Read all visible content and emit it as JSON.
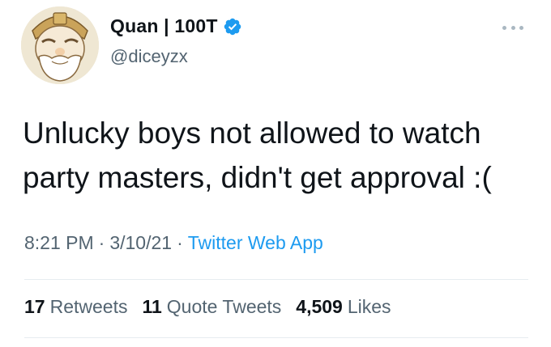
{
  "author": {
    "display_name": "Quan | 100T",
    "handle": "@diceyzx",
    "verified": true,
    "avatar_icon": "cartoon-grandpa-avatar"
  },
  "tweet": {
    "text": "Unlucky boys not allowed to watch party masters, didn't get approval :("
  },
  "meta": {
    "time": "8:21 PM",
    "separator": "·",
    "date": "3/10/21",
    "source": "Twitter Web App"
  },
  "stats": {
    "retweets_count": "17",
    "retweets_label": "Retweets",
    "quotes_count": "11",
    "quotes_label": "Quote Tweets",
    "likes_count": "4,509",
    "likes_label": "Likes"
  },
  "colors": {
    "text": "#0f1419",
    "secondary": "#536471",
    "link": "#1d9bf0",
    "verified": "#1d9bf0",
    "divider": "#e6ecf0"
  }
}
